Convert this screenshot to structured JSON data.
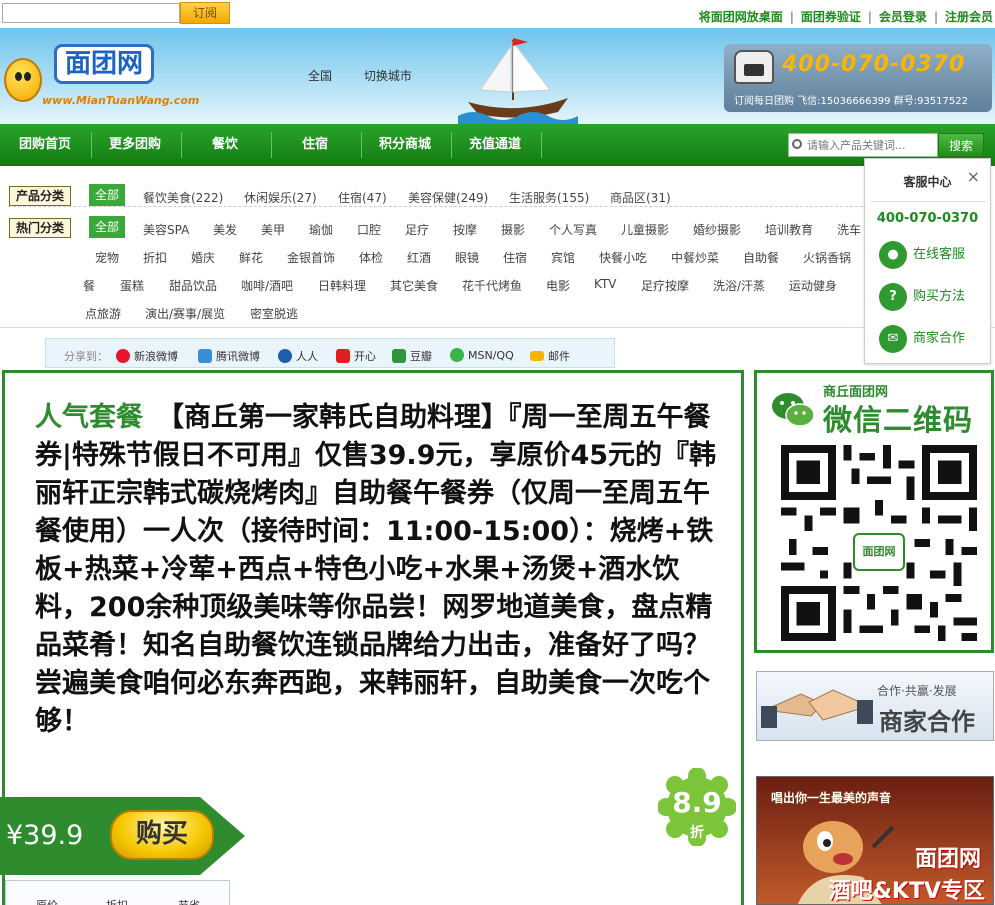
{
  "topbar": {
    "subscribe_placeholder": "",
    "subscribe_label": "订阅",
    "links": [
      "将面团网放桌面",
      "面团券验证",
      "会员登录",
      "注册会员"
    ]
  },
  "header": {
    "logo_text": "面团网",
    "logo_url": "www.MianTuanWang.com",
    "city": "全国",
    "switch_city": "切换城市",
    "hotline": "400-070-0370",
    "hotline_sub": "订阅每日团购 飞信:15036666399 群号:93517522"
  },
  "nav": {
    "items": [
      "团购首页",
      "更多团购",
      "餐饮",
      "住宿",
      "积分商城",
      "充值通道"
    ],
    "search_placeholder": "请输入产品关键词...",
    "search_label": "搜索"
  },
  "categories": {
    "product_label": "产品分类",
    "hot_label": "热门分类",
    "all_label": "全部",
    "products": [
      "餐饮美食(222)",
      "休闲娱乐(27)",
      "住宿(47)",
      "美容保健(249)",
      "生活服务(155)",
      "商品区(31)"
    ],
    "hot_row1": [
      "美容SPA",
      "美发",
      "美甲",
      "瑜伽",
      "口腔",
      "足疗",
      "按摩",
      "摄影",
      "个人写真",
      "儿童摄影",
      "婚纱摄影",
      "培训教育",
      "洗车"
    ],
    "hot_row2": [
      "宠物",
      "折扣",
      "婚庆",
      "鲜花",
      "金银首饰",
      "体检",
      "红酒",
      "眼镜",
      "住宿",
      "宾馆",
      "快餐小吃",
      "中餐炒菜",
      "自助餐",
      "火锅香锅"
    ],
    "hot_row3": [
      "餐",
      "蛋糕",
      "甜品饮品",
      "咖啡/酒吧",
      "日韩料理",
      "其它美食",
      "花千代烤鱼",
      "电影",
      "KTV",
      "足疗按摩",
      "洗浴/汗蒸",
      "运动健身"
    ],
    "hot_row4": [
      "点旅游",
      "演出/赛事/展览",
      "密室脱逃"
    ]
  },
  "share": {
    "label": "分享到：",
    "items": [
      "新浪微博",
      "腾讯微博",
      "人人",
      "开心",
      "豆瓣",
      "MSN/QQ",
      "邮件"
    ]
  },
  "service": {
    "title": "客服中心",
    "close": "×",
    "phone": "400-070-0370",
    "items": [
      "在线客服",
      "购买方法",
      "商家合作"
    ]
  },
  "deal": {
    "tag": "人气套餐",
    "title": "【商丘第一家韩氏自助料理】『周一至周五午餐券|特殊节假日不可用』仅售39.9元，享原价45元的『韩丽轩正宗韩式碳烧烤肉』自助餐午餐券（仅周一至周五午餐使用）一人次（接待时间：11:00-15:00）：烧烤+铁板+热菜+冷荤+西点+特色小吃+水果+汤煲+酒水饮料，200余种顶级美味等你品尝！网罗地道美食，盘点精品菜肴！知名自助餐饮连锁品牌给力出击，准备好了吗？尝遍美食咱何必东奔西跑，来韩丽轩，自助美食一次吃个够！",
    "price": "¥39.9",
    "buy_label": "购买",
    "discount_value": "8.9",
    "discount_unit": "折",
    "info_cols": [
      "原价",
      "折扣",
      "节省"
    ]
  },
  "qr": {
    "top": "商丘面团网",
    "title": "微信二维码",
    "badge": "面团网"
  },
  "biz": {
    "sub": "合作·共赢·发展",
    "title": "商家合作"
  },
  "ktv": {
    "slogan": "唱出你一生最美的声音",
    "brand": "面团网",
    "zone": "酒吧&KTV专区"
  },
  "colors": {
    "brand_green": "#2e8b2e",
    "nav_green": "#1a8a1a",
    "accent_orange": "#ffb400"
  }
}
